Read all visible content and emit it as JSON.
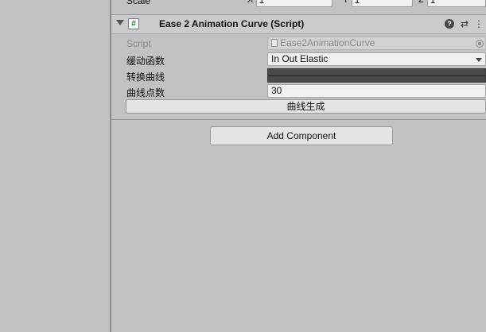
{
  "transform": {
    "scale_label": "Scale",
    "axes": [
      {
        "axis": "X",
        "value": "1"
      },
      {
        "axis": "Y",
        "value": "1"
      },
      {
        "axis": "Z",
        "value": "1"
      }
    ]
  },
  "component": {
    "title": "Ease 2 Animation Curve (Script)",
    "enabled_mark": "#",
    "help_glyph": "?",
    "presets_glyph": "⇄",
    "menu_glyph": "⋮"
  },
  "properties": {
    "script": {
      "label": "Script",
      "value": "Ease2AnimationCurve"
    },
    "ease_function": {
      "label": "缓动函数",
      "value": "In Out Elastic"
    },
    "curve": {
      "label": "转换曲线"
    },
    "point_count": {
      "label": "曲线点数",
      "value": "30"
    }
  },
  "buttons": {
    "generate_label": "曲线生成",
    "add_component_label": "Add Component"
  }
}
